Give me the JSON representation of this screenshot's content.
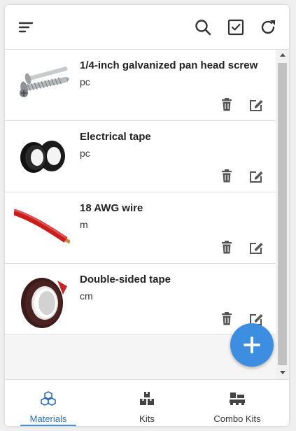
{
  "toolbar": {
    "menu_icon": "sort-lines-icon",
    "search_icon": "search-icon",
    "select_icon": "checkbox-icon",
    "refresh_icon": "refresh-icon"
  },
  "materials": [
    {
      "name": "1/4-inch galvanized pan head screw",
      "unit": "pc",
      "thumb": "screw"
    },
    {
      "name": "Electrical tape",
      "unit": "pc",
      "thumb": "electrical-tape"
    },
    {
      "name": "18 AWG wire",
      "unit": "m",
      "thumb": "red-wire"
    },
    {
      "name": "Double-sided tape",
      "unit": "cm",
      "thumb": "double-sided-tape"
    }
  ],
  "fab": {
    "icon": "plus-icon"
  },
  "nav": {
    "tabs": [
      {
        "label": "Materials",
        "icon": "cubes-icon",
        "active": true
      },
      {
        "label": "Kits",
        "icon": "boxes-icon",
        "active": false
      },
      {
        "label": "Combo Kits",
        "icon": "pallet-icon",
        "active": false
      }
    ]
  },
  "colors": {
    "accent": "#3d8de0",
    "active_label": "#2d6fb5",
    "icon": "#333333"
  }
}
